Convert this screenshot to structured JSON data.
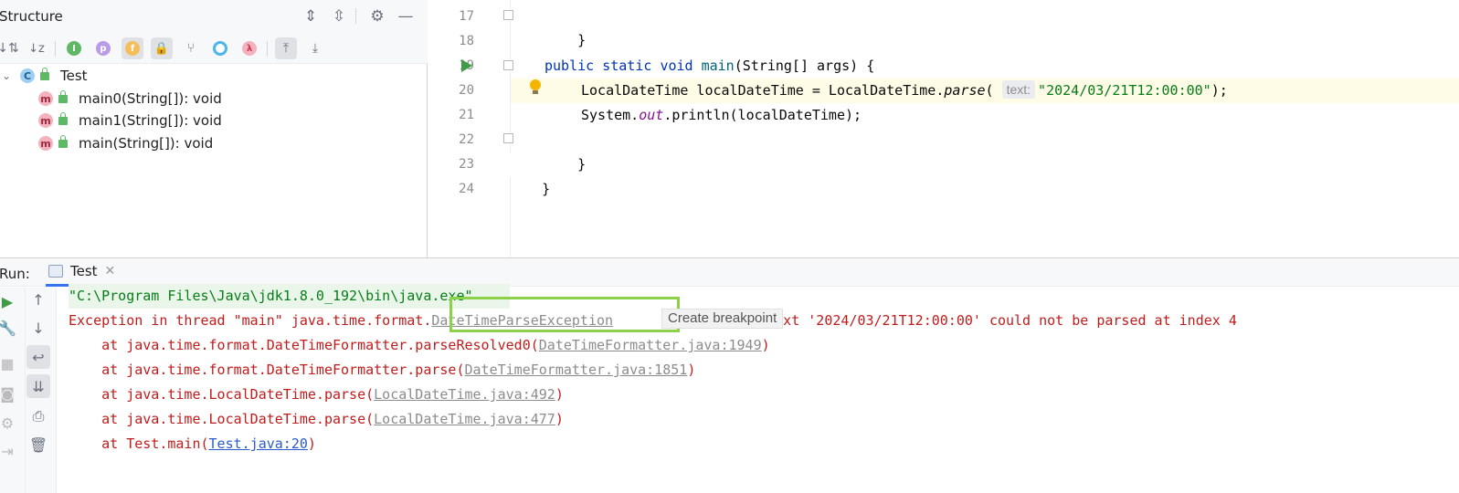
{
  "structure": {
    "title": "Structure",
    "tree": {
      "root": {
        "label": "Test",
        "icon": "class-icon"
      },
      "items": [
        {
          "label": "main0(String[]): void",
          "icon": "method-icon"
        },
        {
          "label": "main1(String[]): void",
          "icon": "method-icon"
        },
        {
          "label": "main(String[]): void",
          "icon": "method-icon"
        }
      ]
    }
  },
  "editor": {
    "line_numbers": [
      "17",
      "18",
      "19",
      "20",
      "21",
      "22",
      "23",
      "24"
    ],
    "lines": {
      "l17": "}",
      "l19": {
        "kw1": "public",
        "kw2": "static",
        "kw3": "void",
        "name": "main",
        "rest": "(String[] args) {"
      },
      "l20": {
        "p1": "LocalDateTime localDateTime = LocalDateTime.",
        "method": "parse",
        "p2": "(",
        "hint": "text:",
        "str": "\"2024/03/21T12:00:00\"",
        "p3": ");"
      },
      "l21": {
        "p1": "System.",
        "field": "out",
        "p2": ".println(localDateTime);"
      },
      "l22": "}",
      "l23": "}"
    }
  },
  "run": {
    "label": "Run:",
    "tab_label": "Test",
    "console": {
      "cmd": "\"C:\\Program Files\\Java\\jdk1.8.0_192\\bin\\java.exe\"",
      "exc_prefix": "Exception in thread \"main\" java.time.format.",
      "exc_link": "DateTimeParseException",
      "tooltip": "Create breakpoint",
      "exc_suffix": ": Text '2024/03/21T12:00:00' could not be parsed at index 4",
      "frames": [
        {
          "prefix": "    at java.time.format.DateTimeFormatter.parseResolved0(",
          "link": "DateTimeFormatter.java:1949",
          "suffix": ")"
        },
        {
          "prefix": "    at java.time.format.DateTimeFormatter.parse(",
          "link": "DateTimeFormatter.java:1851",
          "suffix": ")"
        },
        {
          "prefix": "    at java.time.LocalDateTime.parse(",
          "link": "LocalDateTime.java:492",
          "suffix": ")"
        },
        {
          "prefix": "    at java.time.LocalDateTime.parse(",
          "link": "LocalDateTime.java:477",
          "suffix": ")"
        },
        {
          "prefix": "    at Test.main(",
          "link": "Test.java:20",
          "suffix": ")"
        }
      ]
    }
  },
  "colors": {
    "keyword": "#0033b3",
    "string": "#067d17",
    "error": "#c01c1c",
    "highlight_box": "#8bd14a"
  }
}
